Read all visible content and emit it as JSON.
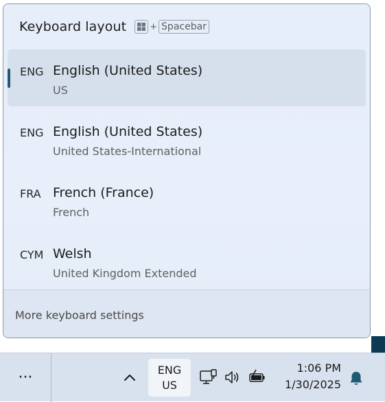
{
  "flyout": {
    "title": "Keyboard layout",
    "shortcut": {
      "plus": "+",
      "key": "Spacebar"
    },
    "languages": [
      {
        "abbr": "ENG",
        "name": "English (United States)",
        "layout": "US",
        "selected": true
      },
      {
        "abbr": "ENG",
        "name": "English (United States)",
        "layout": "United States-International",
        "selected": false
      },
      {
        "abbr": "FRA",
        "name": "French (France)",
        "layout": "French",
        "selected": false
      },
      {
        "abbr": "CYM",
        "name": "Welsh",
        "layout": "United Kingdom Extended",
        "selected": false
      }
    ],
    "footer_link": "More keyboard settings"
  },
  "taskbar": {
    "overflow_label": "···",
    "input_indicator": {
      "line1": "ENG",
      "line2": "US"
    },
    "time": "1:06 PM",
    "date": "1/30/2025",
    "icons": [
      "chevron-up-icon",
      "network-icon",
      "volume-icon",
      "battery-charging-icon",
      "notification-bell-icon"
    ]
  },
  "colors": {
    "flyout_bg": "#e6eef9",
    "selected_bg": "#d6e0ec",
    "accent": "#1f5a73",
    "taskbar_bg": "#d8e2ee",
    "bell": "#1f5a73"
  }
}
